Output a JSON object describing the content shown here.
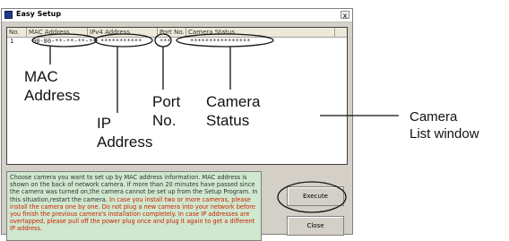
{
  "window": {
    "title": "Easy Setup",
    "close_glyph": "x"
  },
  "list": {
    "columns": [
      "No.",
      "MAC Address",
      "IPv4 Address",
      "Port No.",
      "Camera Status"
    ],
    "row": {
      "no": "1",
      "mac": "00-80-**-**-**-**",
      "ip": "***********",
      "port": "***",
      "status": "****************"
    }
  },
  "info": {
    "text_black": "Choose camera you want to set up by MAC address information. MAC address is shown on the back of network camera. If more than 20 minutes have passed since the camera was turned on,the camera cannot be set up from the Setup Program. In this situation,restart the camera.",
    "text_red": "In case you install two or more cameras, please install the camera one by one. Do not plug a new camera into your network before you finish the previous camera's installation completely. In case IP addresses are overlapped, please pull off the power plug once and plug it again to get a different IP address."
  },
  "buttons": {
    "execute": "Execute",
    "close": "Close"
  },
  "annotations": {
    "mac_line1": "MAC",
    "mac_line2": "Address",
    "ip_line1": "IP",
    "ip_line2": "Address",
    "port_line1": "Port",
    "port_line2": "No.",
    "status_line1": "Camera",
    "status_line2": "Status",
    "list_line1": "Camera",
    "list_line2": "List window"
  }
}
